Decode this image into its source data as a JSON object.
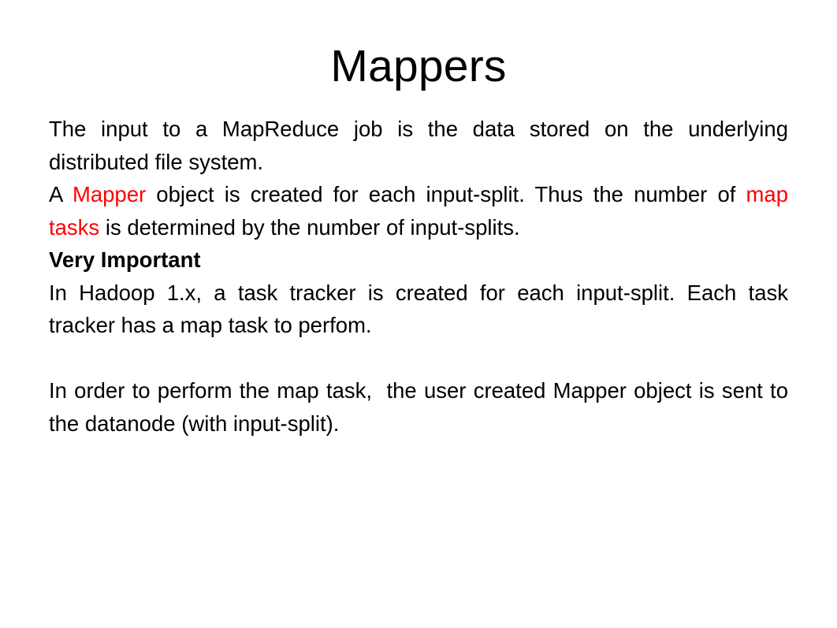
{
  "slide": {
    "title": "Mappers",
    "background_color": "#ffffff",
    "text_color": "#000000",
    "highlight_color": "#ff0000",
    "paragraphs": [
      {
        "id": "p1",
        "bold": false,
        "runs": [
          {
            "text": "The input to a MapReduce job is the data stored on the underlying distributed file system.",
            "color": "default"
          }
        ]
      },
      {
        "id": "p2",
        "bold": false,
        "runs": [
          {
            "text": "A ",
            "color": "default"
          },
          {
            "text": "Mapper",
            "color": "red"
          },
          {
            "text": " object is created for each input-split. Thus the number of ",
            "color": "default"
          },
          {
            "text": "map tasks",
            "color": "red"
          },
          {
            "text": " is determined by the number of input-splits.",
            "color": "default"
          }
        ]
      },
      {
        "id": "p3",
        "bold": true,
        "runs": [
          {
            "text": "Very Important",
            "color": "default"
          }
        ]
      },
      {
        "id": "p4",
        "bold": false,
        "runs": [
          {
            "text": "In Hadoop 1.x, a task tracker is created for each input-split. Each task tracker has a map task to perfom.",
            "color": "default"
          }
        ]
      },
      {
        "id": "p5",
        "bold": false,
        "runs": [
          {
            "text": "In order to perform the map task,  the user created Mapper object is sent to the datanode (with input-split).",
            "color": "default"
          }
        ]
      }
    ]
  }
}
